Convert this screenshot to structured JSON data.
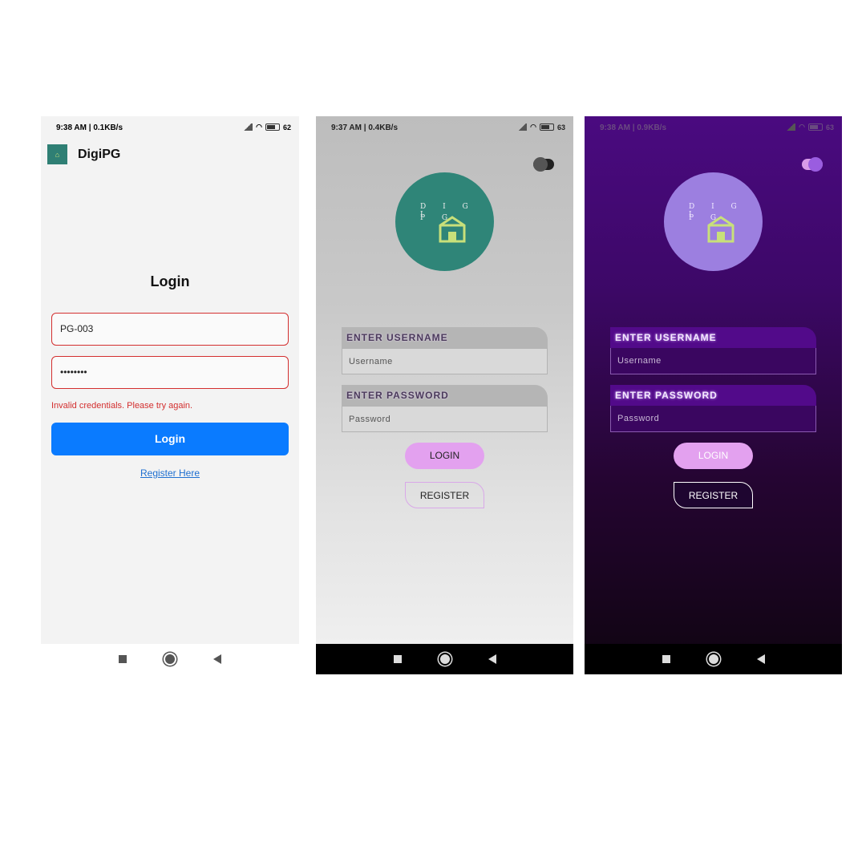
{
  "screen1": {
    "status": {
      "time": "9:38 AM | 0.1KB/s",
      "battery": "62"
    },
    "app_title": "DigiPG",
    "heading": "Login",
    "username_value": "PG-003",
    "password_value": "••••••••",
    "error_text": "Invalid credentials. Please try again.",
    "login_button": "Login",
    "register_link": "Register Here"
  },
  "screen2": {
    "status": {
      "time": "9:37 AM | 0.4KB/s",
      "battery": "63"
    },
    "logo_line1": "D I G I",
    "logo_line2": "P G",
    "username_label": "ENTER USERNAME",
    "username_placeholder": "Username",
    "password_label": "ENTER PASSWORD",
    "password_placeholder": "Password",
    "login_button": "LOGIN",
    "register_button": "REGISTER",
    "theme_toggle_on": false
  },
  "screen3": {
    "status": {
      "time": "9:38 AM | 0.9KB/s",
      "battery": "63"
    },
    "logo_line1": "D I G I",
    "logo_line2": "P G",
    "username_label": "ENTER USERNAME",
    "username_placeholder": "Username",
    "password_label": "ENTER PASSWORD",
    "password_placeholder": "Password",
    "login_button": "LOGIN",
    "register_button": "REGISTER",
    "theme_toggle_on": true
  },
  "colors": {
    "primary_blue": "#0a7bff",
    "error_red": "#d32f2f",
    "accent_pink": "#e3a1ef",
    "logo_teal": "#2f8578",
    "dark_purple": "#4a0a80"
  }
}
